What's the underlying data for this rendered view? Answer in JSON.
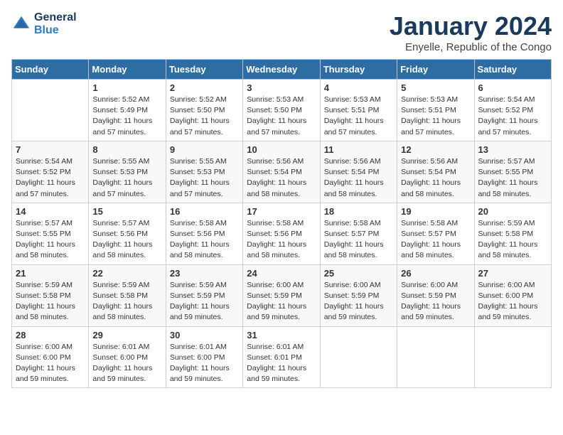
{
  "logo": {
    "line1": "General",
    "line2": "Blue"
  },
  "title": "January 2024",
  "location": "Enyelle, Republic of the Congo",
  "days_of_week": [
    "Sunday",
    "Monday",
    "Tuesday",
    "Wednesday",
    "Thursday",
    "Friday",
    "Saturday"
  ],
  "weeks": [
    [
      {
        "day": "",
        "info": ""
      },
      {
        "day": "1",
        "info": "Sunrise: 5:52 AM\nSunset: 5:49 PM\nDaylight: 11 hours\nand 57 minutes."
      },
      {
        "day": "2",
        "info": "Sunrise: 5:52 AM\nSunset: 5:50 PM\nDaylight: 11 hours\nand 57 minutes."
      },
      {
        "day": "3",
        "info": "Sunrise: 5:53 AM\nSunset: 5:50 PM\nDaylight: 11 hours\nand 57 minutes."
      },
      {
        "day": "4",
        "info": "Sunrise: 5:53 AM\nSunset: 5:51 PM\nDaylight: 11 hours\nand 57 minutes."
      },
      {
        "day": "5",
        "info": "Sunrise: 5:53 AM\nSunset: 5:51 PM\nDaylight: 11 hours\nand 57 minutes."
      },
      {
        "day": "6",
        "info": "Sunrise: 5:54 AM\nSunset: 5:52 PM\nDaylight: 11 hours\nand 57 minutes."
      }
    ],
    [
      {
        "day": "7",
        "info": "Sunrise: 5:54 AM\nSunset: 5:52 PM\nDaylight: 11 hours\nand 57 minutes."
      },
      {
        "day": "8",
        "info": "Sunrise: 5:55 AM\nSunset: 5:53 PM\nDaylight: 11 hours\nand 57 minutes."
      },
      {
        "day": "9",
        "info": "Sunrise: 5:55 AM\nSunset: 5:53 PM\nDaylight: 11 hours\nand 57 minutes."
      },
      {
        "day": "10",
        "info": "Sunrise: 5:56 AM\nSunset: 5:54 PM\nDaylight: 11 hours\nand 58 minutes."
      },
      {
        "day": "11",
        "info": "Sunrise: 5:56 AM\nSunset: 5:54 PM\nDaylight: 11 hours\nand 58 minutes."
      },
      {
        "day": "12",
        "info": "Sunrise: 5:56 AM\nSunset: 5:54 PM\nDaylight: 11 hours\nand 58 minutes."
      },
      {
        "day": "13",
        "info": "Sunrise: 5:57 AM\nSunset: 5:55 PM\nDaylight: 11 hours\nand 58 minutes."
      }
    ],
    [
      {
        "day": "14",
        "info": "Sunrise: 5:57 AM\nSunset: 5:55 PM\nDaylight: 11 hours\nand 58 minutes."
      },
      {
        "day": "15",
        "info": "Sunrise: 5:57 AM\nSunset: 5:56 PM\nDaylight: 11 hours\nand 58 minutes."
      },
      {
        "day": "16",
        "info": "Sunrise: 5:58 AM\nSunset: 5:56 PM\nDaylight: 11 hours\nand 58 minutes."
      },
      {
        "day": "17",
        "info": "Sunrise: 5:58 AM\nSunset: 5:56 PM\nDaylight: 11 hours\nand 58 minutes."
      },
      {
        "day": "18",
        "info": "Sunrise: 5:58 AM\nSunset: 5:57 PM\nDaylight: 11 hours\nand 58 minutes."
      },
      {
        "day": "19",
        "info": "Sunrise: 5:58 AM\nSunset: 5:57 PM\nDaylight: 11 hours\nand 58 minutes."
      },
      {
        "day": "20",
        "info": "Sunrise: 5:59 AM\nSunset: 5:58 PM\nDaylight: 11 hours\nand 58 minutes."
      }
    ],
    [
      {
        "day": "21",
        "info": "Sunrise: 5:59 AM\nSunset: 5:58 PM\nDaylight: 11 hours\nand 58 minutes."
      },
      {
        "day": "22",
        "info": "Sunrise: 5:59 AM\nSunset: 5:58 PM\nDaylight: 11 hours\nand 58 minutes."
      },
      {
        "day": "23",
        "info": "Sunrise: 5:59 AM\nSunset: 5:59 PM\nDaylight: 11 hours\nand 59 minutes."
      },
      {
        "day": "24",
        "info": "Sunrise: 6:00 AM\nSunset: 5:59 PM\nDaylight: 11 hours\nand 59 minutes."
      },
      {
        "day": "25",
        "info": "Sunrise: 6:00 AM\nSunset: 5:59 PM\nDaylight: 11 hours\nand 59 minutes."
      },
      {
        "day": "26",
        "info": "Sunrise: 6:00 AM\nSunset: 5:59 PM\nDaylight: 11 hours\nand 59 minutes."
      },
      {
        "day": "27",
        "info": "Sunrise: 6:00 AM\nSunset: 6:00 PM\nDaylight: 11 hours\nand 59 minutes."
      }
    ],
    [
      {
        "day": "28",
        "info": "Sunrise: 6:00 AM\nSunset: 6:00 PM\nDaylight: 11 hours\nand 59 minutes."
      },
      {
        "day": "29",
        "info": "Sunrise: 6:01 AM\nSunset: 6:00 PM\nDaylight: 11 hours\nand 59 minutes."
      },
      {
        "day": "30",
        "info": "Sunrise: 6:01 AM\nSunset: 6:00 PM\nDaylight: 11 hours\nand 59 minutes."
      },
      {
        "day": "31",
        "info": "Sunrise: 6:01 AM\nSunset: 6:01 PM\nDaylight: 11 hours\nand 59 minutes."
      },
      {
        "day": "",
        "info": ""
      },
      {
        "day": "",
        "info": ""
      },
      {
        "day": "",
        "info": ""
      }
    ]
  ]
}
